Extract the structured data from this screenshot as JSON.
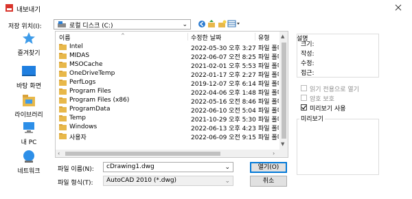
{
  "window": {
    "title": "내보내기"
  },
  "location": {
    "label": "저장 위치(I):",
    "value": "로컬 디스크 (C:)"
  },
  "places": [
    {
      "label": "즐겨찾기",
      "icon": "star-icon"
    },
    {
      "label": "바탕 화면",
      "icon": "desktop-icon"
    },
    {
      "label": "라이브러리",
      "icon": "library-icon"
    },
    {
      "label": "내 PC",
      "icon": "computer-icon"
    },
    {
      "label": "네트워크",
      "icon": "network-icon"
    }
  ],
  "columns": {
    "name": "이름",
    "date": "수정한 날짜",
    "type": "유형"
  },
  "files": [
    {
      "name": "Intel",
      "date": "2022-05-30 오후 3:27",
      "type": "파일 폴더"
    },
    {
      "name": "MIDAS",
      "date": "2022-06-07 오전 8:25",
      "type": "파일 폴더"
    },
    {
      "name": "MSOCache",
      "date": "2021-02-01 오후 5:53",
      "type": "파일 폴더"
    },
    {
      "name": "OneDriveTemp",
      "date": "2022-01-17 오후 2:27",
      "type": "파일 폴더"
    },
    {
      "name": "PerfLogs",
      "date": "2019-12-07 오후 6:14",
      "type": "파일 폴더"
    },
    {
      "name": "Program Files",
      "date": "2022-04-06 오후 1:48",
      "type": "파일 폴더"
    },
    {
      "name": "Program Files (x86)",
      "date": "2022-05-16 오전 8:46",
      "type": "파일 폴더"
    },
    {
      "name": "ProgramData",
      "date": "2022-06-10 오전 5:04",
      "type": "파일 폴더"
    },
    {
      "name": "Temp",
      "date": "2021-10-29 오후 5:30",
      "type": "파일 폴더"
    },
    {
      "name": "Windows",
      "date": "2022-06-13 오후 4:23",
      "type": "파일 폴더"
    },
    {
      "name": "사용자",
      "date": "2022-06-09 오전 9:15",
      "type": "파일 폴더"
    }
  ],
  "filename": {
    "label": "파일 이름(N):",
    "value": "cDrawing1.dwg"
  },
  "filetype": {
    "label": "파일 형식(T):",
    "value": "AutoCAD 2010 (*.dwg)"
  },
  "buttons": {
    "save": "열기(O)",
    "cancel": "취소"
  },
  "description": {
    "caption": "설명",
    "fields": [
      "크기:",
      "작성:",
      "수정:",
      "접근:"
    ]
  },
  "options": {
    "readonly": {
      "label": "읽기 전용으로 열기",
      "checked": false,
      "enabled": false
    },
    "password": {
      "label": "암호 보호",
      "checked": false,
      "enabled": false
    },
    "preview": {
      "label": "미리보기 사용",
      "checked": true,
      "enabled": true
    }
  },
  "preview_caption": "미리보기",
  "colors": {
    "folder": "#e8b84a",
    "accent": "#0078d7",
    "close": "#333333"
  }
}
